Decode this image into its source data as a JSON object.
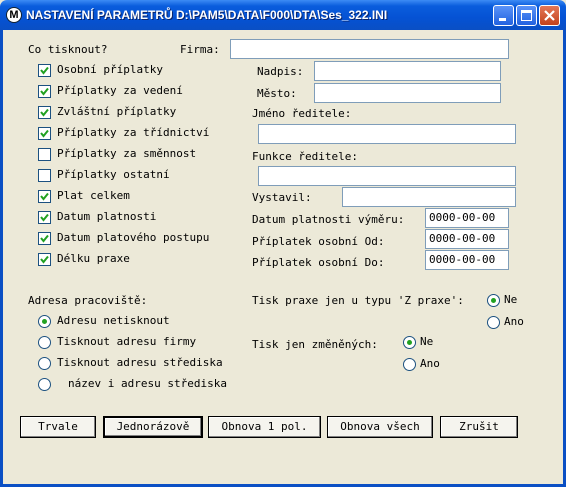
{
  "window": {
    "title": "NASTAVENÍ PARAMETRŮ  D:\\PAM5\\DATA\\F000\\DTA\\Ses_322.INI",
    "icon_letter": "M"
  },
  "co_tisknout": "Co tisknout?",
  "firma": {
    "label": "Firma:",
    "value": ""
  },
  "checkboxes": [
    {
      "label": "Osobní příplatky",
      "checked": true
    },
    {
      "label": "Příplatky za vedení",
      "checked": true
    },
    {
      "label": "Zvláštní příplatky",
      "checked": true
    },
    {
      "label": "Příplatky za třídnictví",
      "checked": true
    },
    {
      "label": "Příplatky za směnnost",
      "checked": false
    },
    {
      "label": "Příplatky ostatní",
      "checked": false
    },
    {
      "label": "Plat celkem",
      "checked": true
    },
    {
      "label": "Datum platnosti",
      "checked": true
    },
    {
      "label": "Datum platového postupu",
      "checked": true
    },
    {
      "label": "Délku praxe",
      "checked": true
    }
  ],
  "nadpis": {
    "label": "Nadpis:",
    "value": ""
  },
  "mesto": {
    "label": "Město:",
    "value": ""
  },
  "jmeno_reditele": {
    "label": "Jméno ředitele:",
    "value": ""
  },
  "funkce_reditele": {
    "label": "Funkce ředitele:",
    "value": ""
  },
  "vystavil": {
    "label": "Vystavil:",
    "value": ""
  },
  "datum_platnosti_vymeru": {
    "label": "Datum platnosti výměru:",
    "value": "0000-00-00"
  },
  "priplatek_od": {
    "label": "Příplatek osobní Od:",
    "value": "0000-00-00"
  },
  "priplatek_do": {
    "label": "Příplatek osobní Do:",
    "value": "0000-00-00"
  },
  "adresa": {
    "label": "Adresa pracoviště:",
    "options": [
      {
        "label": "Adresu netisknout",
        "selected": true
      },
      {
        "label": "Tisknout adresu firmy",
        "selected": false
      },
      {
        "label": "Tisknout adresu střediska",
        "selected": false
      },
      {
        "label": "název i adresu střediska",
        "selected": false
      }
    ]
  },
  "tisk_praxe": {
    "label": "Tisk praxe jen u typu 'Z praxe':",
    "options": [
      {
        "label": "Ne",
        "selected": true
      },
      {
        "label": "Ano",
        "selected": false
      }
    ]
  },
  "tisk_zmenenych": {
    "label": "Tisk jen změněných:",
    "options": [
      {
        "label": "Ne",
        "selected": true
      },
      {
        "label": "Ano",
        "selected": false
      }
    ]
  },
  "buttons": {
    "trvale": "Trvale",
    "jednorazove": "Jednorázově",
    "obnova_pol": "Obnova 1 pol.",
    "obnova_vsech": "Obnova všech",
    "zrusit": "Zrušit"
  }
}
